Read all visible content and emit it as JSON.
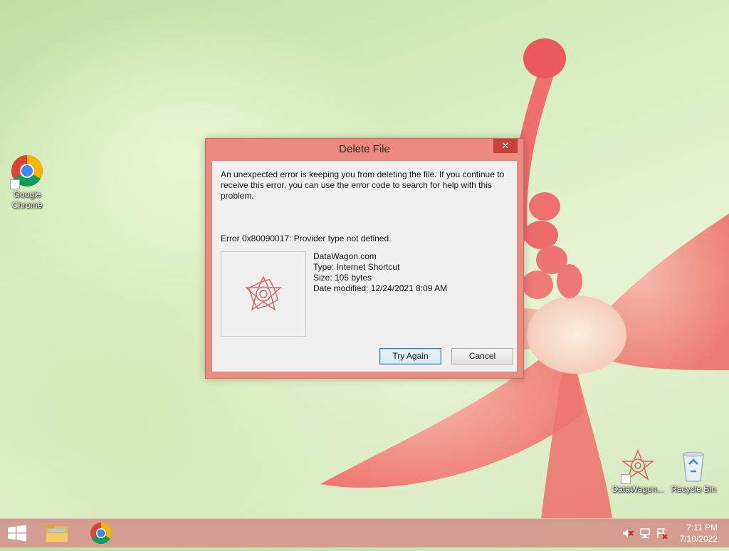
{
  "desktop": {
    "icons": [
      {
        "label": "Google Chrome"
      },
      {
        "label": "DataWagon..."
      },
      {
        "label": "Recycle Bin"
      }
    ]
  },
  "dialog": {
    "title": "Delete File",
    "close_symbol": "✕",
    "message": "An unexpected error is keeping you from deleting the file. If you continue to receive this error, you can use the error code to search for help with this problem.",
    "error": "Error 0x80090017: Provider type not defined.",
    "file": {
      "name": "DataWagon.com",
      "type": "Type: Internet Shortcut",
      "size": "Size: 105 bytes",
      "modified": "Date modified: 12/24/2021 8:09 AM"
    },
    "buttons": {
      "try_again": "Try Again",
      "cancel": "Cancel"
    }
  },
  "taskbar": {
    "items": [
      "start-icon",
      "file-explorer-icon",
      "chrome-icon"
    ],
    "tray": [
      "volume-muted-icon",
      "network-icon",
      "action-center-icon"
    ],
    "time": "7:11 PM",
    "date": "7/10/2022"
  },
  "colors": {
    "dialog_frame": "#ec8a80",
    "close_button": "#c7413a",
    "taskbar": "#d2968c"
  }
}
